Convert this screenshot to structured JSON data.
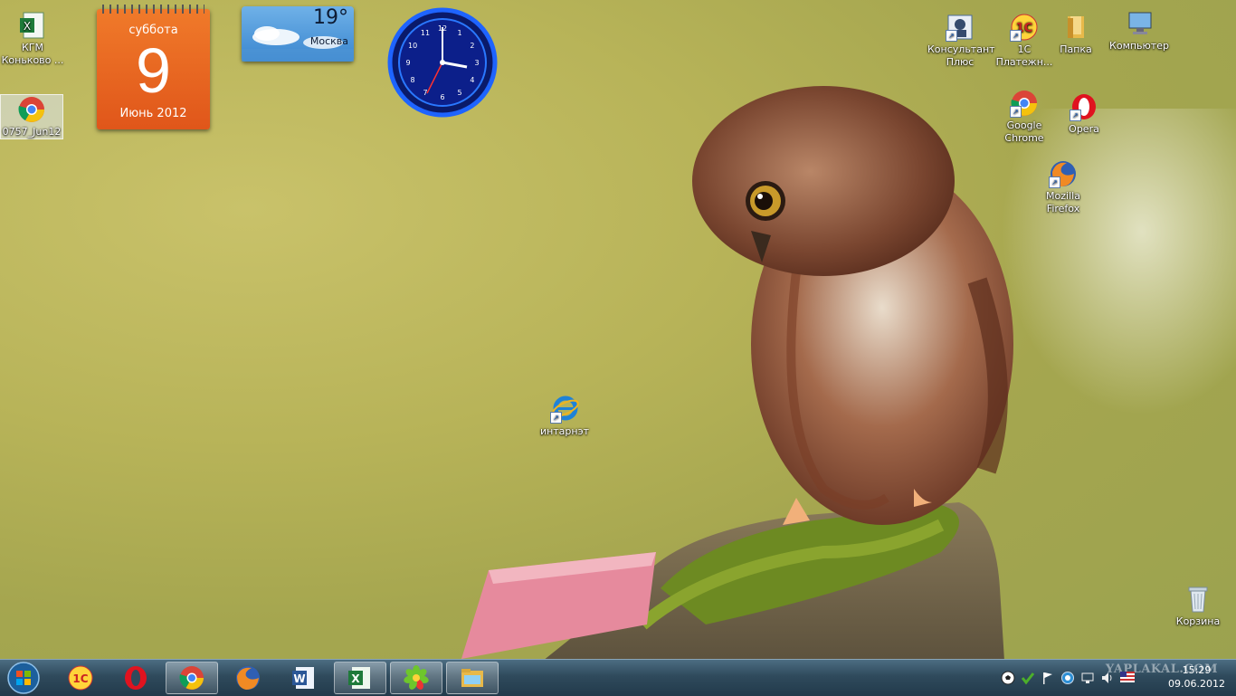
{
  "desktop": {
    "icons": [
      {
        "label": "КГМ Коньково ...",
        "icon": "excel-file-icon"
      },
      {
        "label": "0757_Jun12",
        "icon": "chrome-icon"
      },
      {
        "label": "Консультант Плюс",
        "icon": "consultant-icon"
      },
      {
        "label": "1С Платежн...",
        "icon": "1c-icon"
      },
      {
        "label": "Папка",
        "icon": "folder-icon"
      },
      {
        "label": "Компьютер",
        "icon": "computer-icon"
      },
      {
        "label": "Google Chrome",
        "icon": "chrome-icon"
      },
      {
        "label": "Opera",
        "icon": "opera-icon"
      },
      {
        "label": "Mozilla Firefox",
        "icon": "firefox-icon"
      },
      {
        "label": "интарнэт",
        "icon": "ie-icon"
      },
      {
        "label": "Корзина",
        "icon": "recycle-bin-icon"
      }
    ]
  },
  "calendar_gadget": {
    "weekday": "суббота",
    "day": "9",
    "month_year": "Июнь 2012"
  },
  "weather_gadget": {
    "temp": "19°",
    "city": "Москва"
  },
  "clock_gadget": {
    "numbers": [
      "12",
      "1",
      "2",
      "3",
      "4",
      "5",
      "6",
      "7",
      "8",
      "9",
      "10",
      "11"
    ],
    "time": "15:29"
  },
  "taskbar": {
    "start_icon": "windows-start-icon",
    "apps": [
      {
        "icon": "1c-icon",
        "active": false
      },
      {
        "icon": "opera-icon",
        "active": false
      },
      {
        "icon": "chrome-icon",
        "active": true
      },
      {
        "icon": "firefox-icon",
        "active": false
      },
      {
        "icon": "word-icon",
        "active": false
      },
      {
        "icon": "excel-icon",
        "active": true
      },
      {
        "icon": "icq-icon",
        "active": true
      },
      {
        "icon": "explorer-icon",
        "active": true
      }
    ],
    "tray_icons": [
      "soccer-icon",
      "antivirus-icon",
      "flag-icon",
      "update-icon",
      "network-icon",
      "volume-icon",
      "language-flag-icon"
    ],
    "clock_time": "15:29",
    "clock_date": "09.06.2012",
    "watermark": "YAPLAKAL.COM"
  },
  "colors": {
    "calendar_orange": "#e8621f",
    "taskbar": "#2f4a5c",
    "clock_neon": "#1e64ff"
  }
}
